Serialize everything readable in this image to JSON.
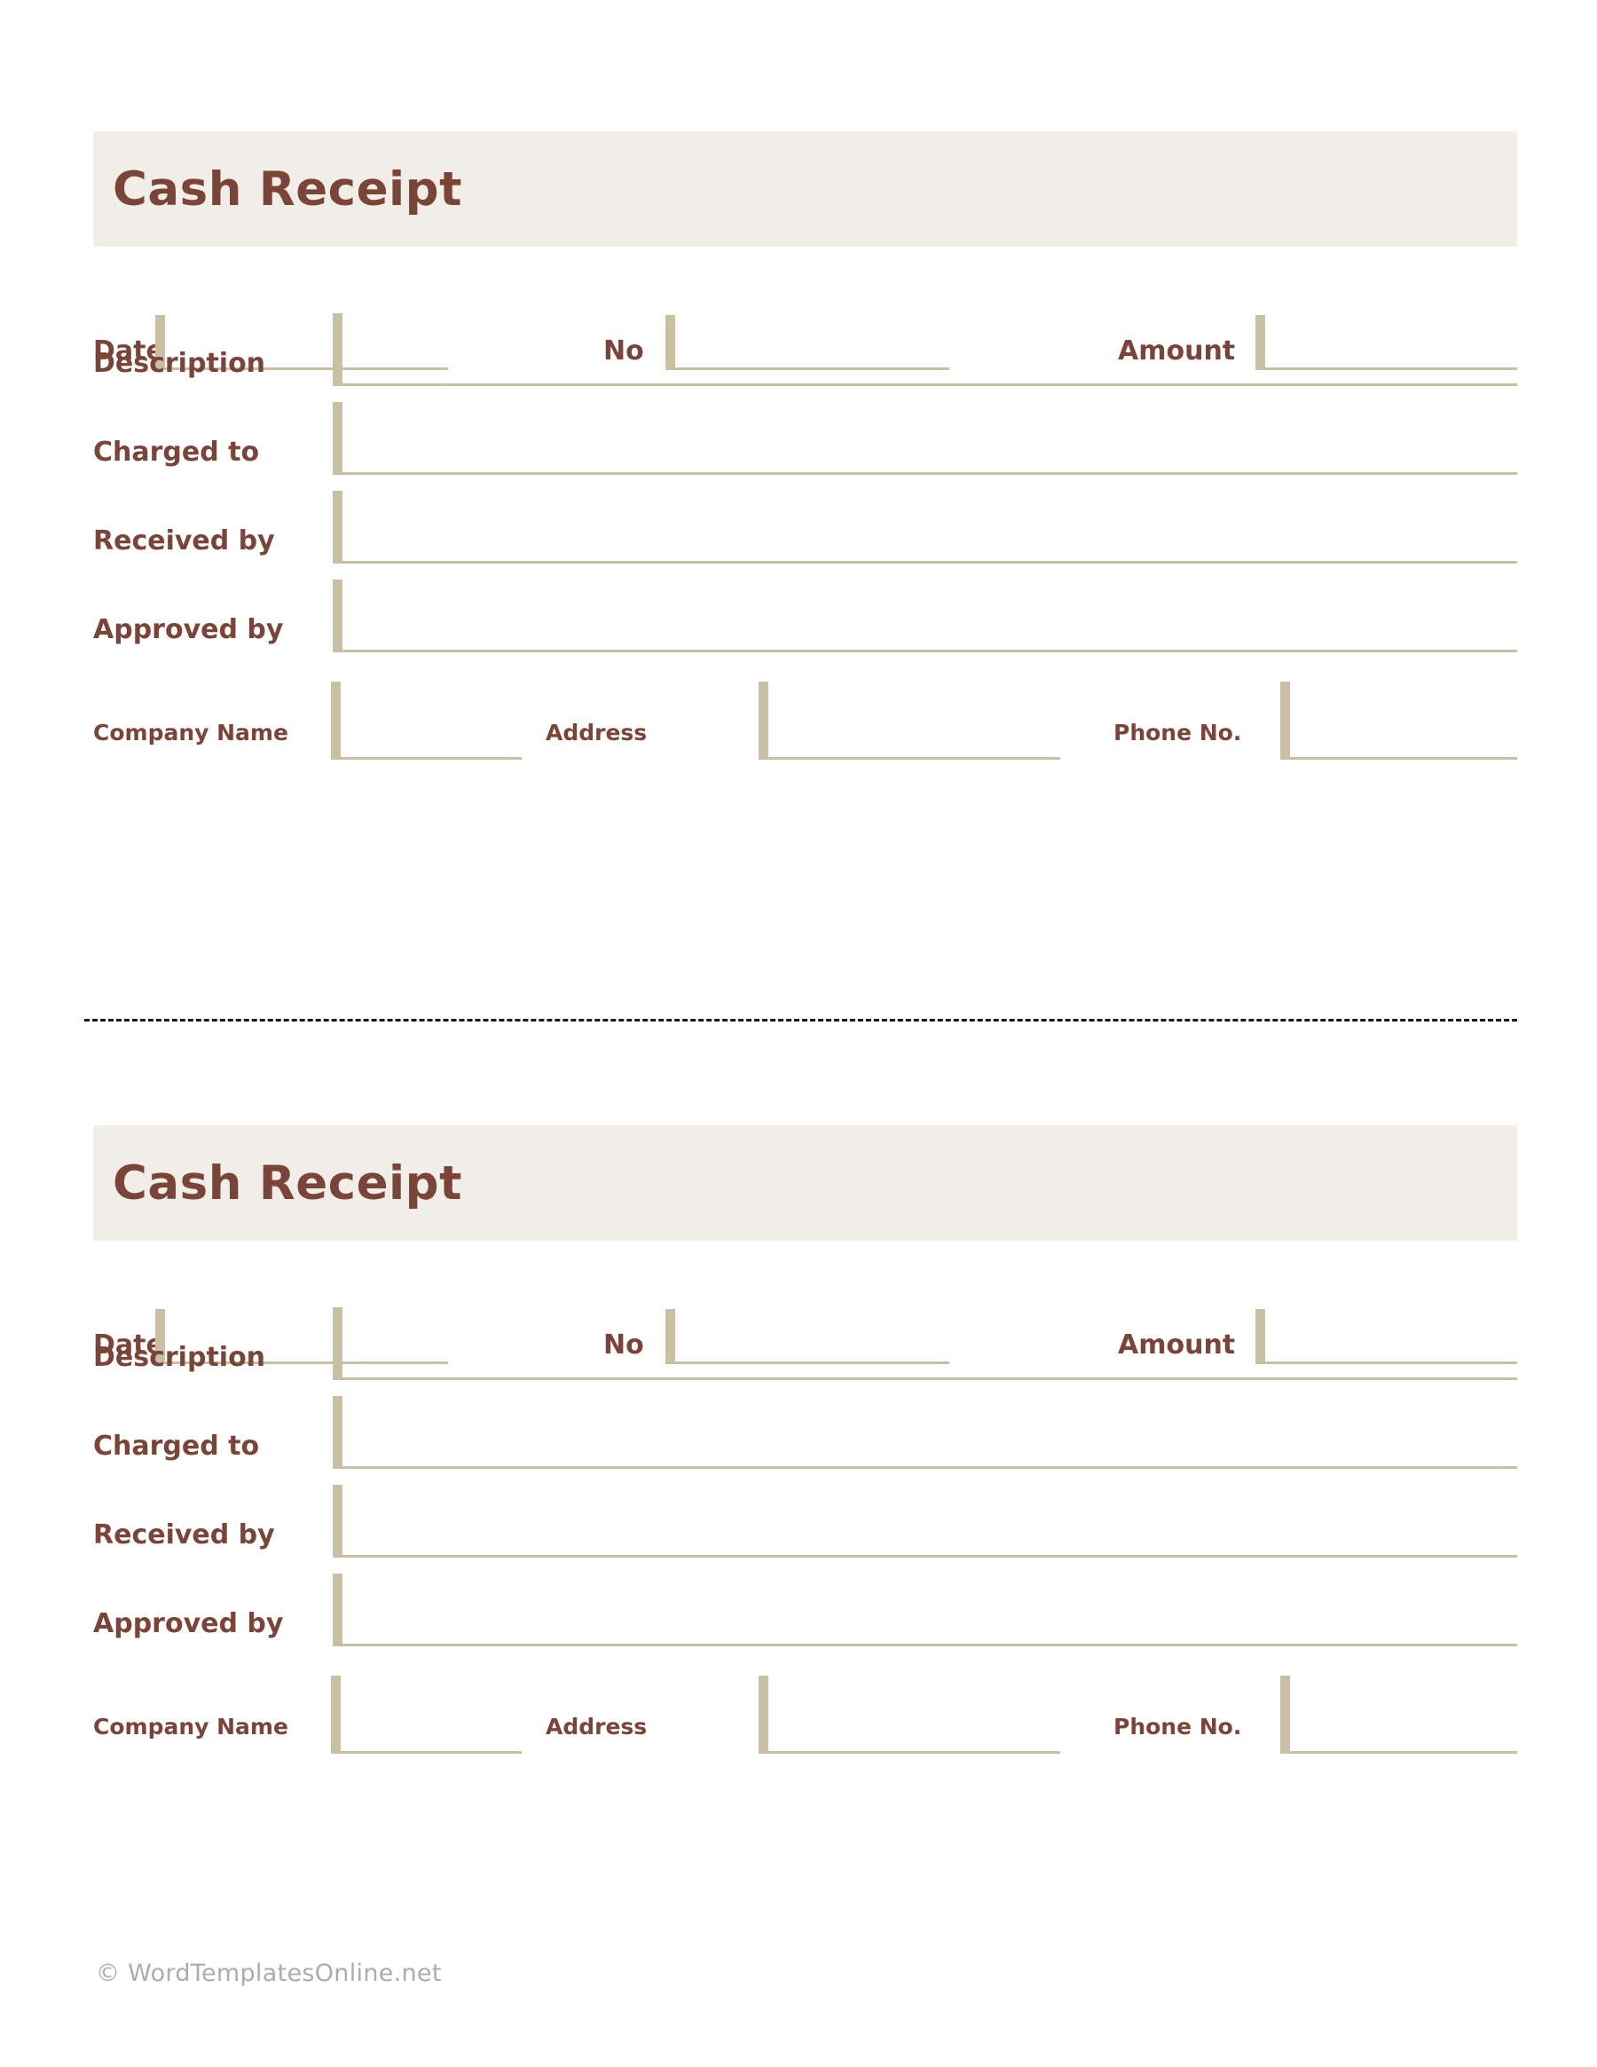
{
  "document": {
    "title": "Cash Receipt",
    "footer_credit": "© WordTemplatesOnline.net"
  },
  "colors": {
    "title_text": "#7A4438",
    "title_band_bg": "#F1EDE7",
    "field_rule": "#C9BFA2",
    "cut_line": "#1A1A1A",
    "footer_text": "#ACACAC",
    "page_bg": "#FFFFFF"
  },
  "receipts": [
    {
      "heading": "Cash Receipt",
      "top_row": [
        {
          "label": "Date",
          "value": "",
          "placeholder": ""
        },
        {
          "label": "No",
          "value": "",
          "placeholder": ""
        },
        {
          "label": "Amount",
          "value": "",
          "placeholder": ""
        }
      ],
      "main_rows": [
        {
          "label": "Description",
          "value": "",
          "placeholder": ""
        },
        {
          "label": "Charged to",
          "value": "",
          "placeholder": ""
        },
        {
          "label": "Received by",
          "value": "",
          "placeholder": ""
        },
        {
          "label": "Approved by",
          "value": "",
          "placeholder": ""
        }
      ],
      "bottom_row": [
        {
          "label": "Company Name",
          "value": "",
          "placeholder": ""
        },
        {
          "label": "Address",
          "value": "",
          "placeholder": ""
        },
        {
          "label": "Phone No.",
          "value": "",
          "placeholder": ""
        }
      ]
    },
    {
      "heading": "Cash Receipt",
      "top_row": [
        {
          "label": "Date",
          "value": "",
          "placeholder": ""
        },
        {
          "label": "No",
          "value": "",
          "placeholder": ""
        },
        {
          "label": "Amount",
          "value": "",
          "placeholder": ""
        }
      ],
      "main_rows": [
        {
          "label": "Description",
          "value": "",
          "placeholder": ""
        },
        {
          "label": "Charged to",
          "value": "",
          "placeholder": ""
        },
        {
          "label": "Received by",
          "value": "",
          "placeholder": ""
        },
        {
          "label": "Approved by",
          "value": "",
          "placeholder": ""
        }
      ],
      "bottom_row": [
        {
          "label": "Company Name",
          "value": "",
          "placeholder": ""
        },
        {
          "label": "Address",
          "value": "",
          "placeholder": ""
        },
        {
          "label": "Phone No.",
          "value": "",
          "placeholder": ""
        }
      ]
    }
  ]
}
